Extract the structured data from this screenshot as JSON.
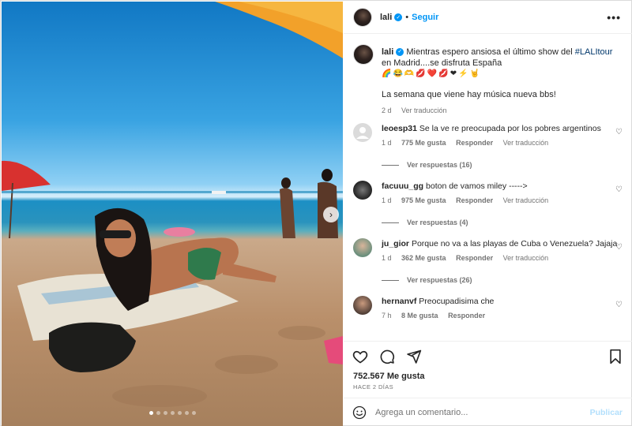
{
  "post": {
    "username": "lali",
    "follow_label": "Seguir",
    "separator": "•",
    "more_label": "•••"
  },
  "caption": {
    "username": "lali",
    "text_before": "Mientras espero ansiosa el último show del ",
    "hashtag": "#LALItour",
    "text_after": " en Madrid....se disfruta España",
    "emojis": "🌈😂🫶💋❤️💋❤⚡🤘",
    "line2": "La semana que viene hay música nueva bbs!",
    "time": "2 d",
    "translate": "Ver traducción"
  },
  "comments": [
    {
      "username": "leoesp31",
      "text": "Se la ve re preocupada por los pobres argentinos",
      "time": "1 d",
      "likes": "775 Me gusta",
      "reply": "Responder",
      "translate": "Ver traducción",
      "replies": "Ver respuestas (16)"
    },
    {
      "username": "facuuu_gg",
      "text": "boton de vamos miley ----->",
      "time": "1 d",
      "likes": "975 Me gusta",
      "reply": "Responder",
      "translate": "Ver traducción",
      "replies": "Ver respuestas (4)"
    },
    {
      "username": "ju_gior",
      "text": "Porque no va a las playas de Cuba o Venezuela? Jajaja",
      "time": "1 d",
      "likes": "362 Me gusta",
      "reply": "Responder",
      "translate": "Ver traducción",
      "replies": "Ver respuestas (26)"
    },
    {
      "username": "hernanvf",
      "text": "Preocupadisima che",
      "time": "7 h",
      "likes": "8 Me gusta",
      "reply": "Responder"
    }
  ],
  "actions": {
    "likes": "752.567 Me gusta",
    "date": "HACE 2 DÍAS"
  },
  "add_comment": {
    "placeholder": "Agrega un comentario...",
    "publish": "Publicar"
  },
  "carousel": {
    "next_icon": "›",
    "total_slides": 7,
    "active_slide": 1
  },
  "colors": {
    "accent": "#0095f6",
    "publish_disabled": "#b2dffc",
    "hashtag": "#00376b",
    "secondary_text": "#737373"
  }
}
